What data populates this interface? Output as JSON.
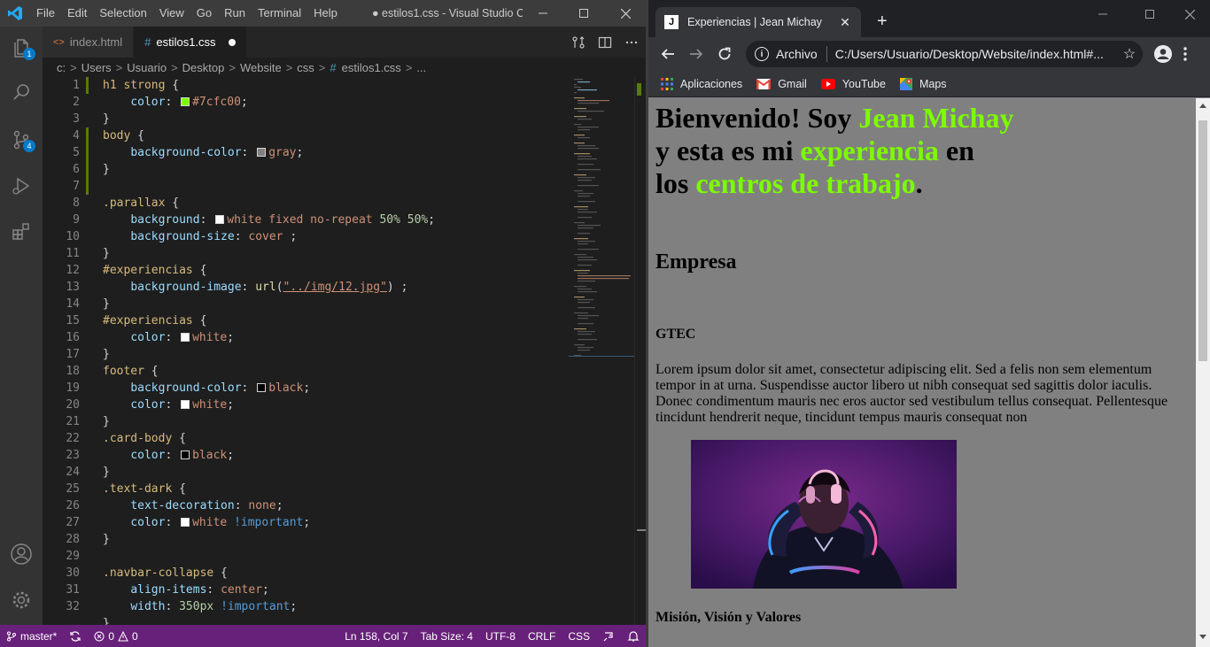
{
  "vscode": {
    "menu": [
      "File",
      "Edit",
      "Selection",
      "View",
      "Go",
      "Run",
      "Terminal",
      "Help"
    ],
    "window_title": "● estilos1.css - Visual Studio C...",
    "tabs": [
      {
        "label": "index.html",
        "icon": "html-file-icon"
      },
      {
        "label": "estilos1.css",
        "icon": "css-file-icon",
        "dirty": true
      }
    ],
    "activity_badges": {
      "explorer": "1",
      "scm": "4"
    },
    "breadcrumb": [
      "c:",
      "Users",
      "Usuario",
      "Desktop",
      "Website",
      "css",
      "estilos1.css",
      "..."
    ],
    "line_numbers": [
      "1",
      "2",
      "3",
      "4",
      "5",
      "6",
      "7",
      "8",
      "9",
      "10",
      "11",
      "12",
      "13",
      "14",
      "15",
      "16",
      "17",
      "18",
      "19",
      "20",
      "21",
      "22",
      "23",
      "24",
      "25",
      "26",
      "27",
      "28",
      "29",
      "30",
      "31",
      "32"
    ],
    "code": {
      "l1_sel": "h1 strong",
      "l2_prop": "color",
      "l2_val": "#7cfc00",
      "l4_sel": "body",
      "l5_prop": "background-color",
      "l5_val": "gray",
      "l8_sel": ".parallax",
      "l9_prop": "background",
      "l9_val": "white fixed no-repeat",
      "l9_n1": "50%",
      "l9_n2": "50%",
      "l10_prop": "background-size",
      "l10_val": "cover",
      "l12_sel": "#experiencias",
      "l13_prop": "background-image",
      "l13_fn": "url",
      "l13_str": "\"../img/12.jpg\"",
      "l15_sel": "#experiencias",
      "l16_prop": "color",
      "l16_val": "white",
      "l18_sel": "footer",
      "l19_prop": "background-color",
      "l19_val": "black",
      "l20_prop": "color",
      "l20_val": "white",
      "l22_sel": ".card-body",
      "l23_prop": "color",
      "l23_val": "black",
      "l25_sel": ".text-dark",
      "l26_prop": "text-decoration",
      "l26_val": "none",
      "l27_prop": "color",
      "l27_val": "white",
      "l27_imp": "!important",
      "l30_sel": ".navbar-collapse",
      "l31_prop": "align-items",
      "l31_val": "center",
      "l32_prop": "width",
      "l32_num": "350px",
      "l32_imp": "!important"
    },
    "swatches": {
      "green": "#7cfc00",
      "gray": "#808080",
      "white": "#ffffff",
      "black": "#000000"
    },
    "status": {
      "branch": "master*",
      "errors": "0",
      "warnings": "0",
      "position": "Ln 158, Col 7",
      "tab_size": "Tab Size: 4",
      "encoding": "UTF-8",
      "eol": "CRLF",
      "language": "CSS"
    },
    "colors": {
      "statusbar": "#68217a",
      "accent": "#007acc"
    }
  },
  "chrome": {
    "tab_title": "Experiencias | Jean Michay",
    "favicon_letter": "J",
    "omnibox_chip": "Archivo",
    "url": "C:/Users/Usuario/Desktop/Website/index.html#...",
    "bookmarks": [
      {
        "label": "Aplicaciones",
        "icon": "apps-grid-icon"
      },
      {
        "label": "Gmail",
        "icon": "gmail-icon"
      },
      {
        "label": "YouTube",
        "icon": "youtube-icon"
      },
      {
        "label": "Maps",
        "icon": "maps-icon"
      }
    ]
  },
  "page": {
    "h1_part1": "Bienvenido! Soy ",
    "h1_name": "Jean Michay",
    "h1_part2": "y esta es mi ",
    "h1_exp": "experiencia",
    "h1_part3": " en",
    "h1_part4": "los ",
    "h1_centros": "centros de trabajo",
    "h1_end": ".",
    "section_title": "Empresa",
    "company": "GTEC",
    "paragraph": "Lorem ipsum dolor sit amet, consectetur adipiscing elit. Sed a felis non sem elementum tempor in at urna. Suspendisse auctor libero ut nibh consequat sed sagittis dolor iaculis. Donec condimentum mauris nec eros auctor sed vestibulum tellus consequat. Pellentesque tincidunt hendrerit neque, tincidunt tempus mauris consequat non",
    "subheading": "Misión, Visión y Valores",
    "accent_color": "#7cfc00",
    "background_color": "#808080"
  }
}
